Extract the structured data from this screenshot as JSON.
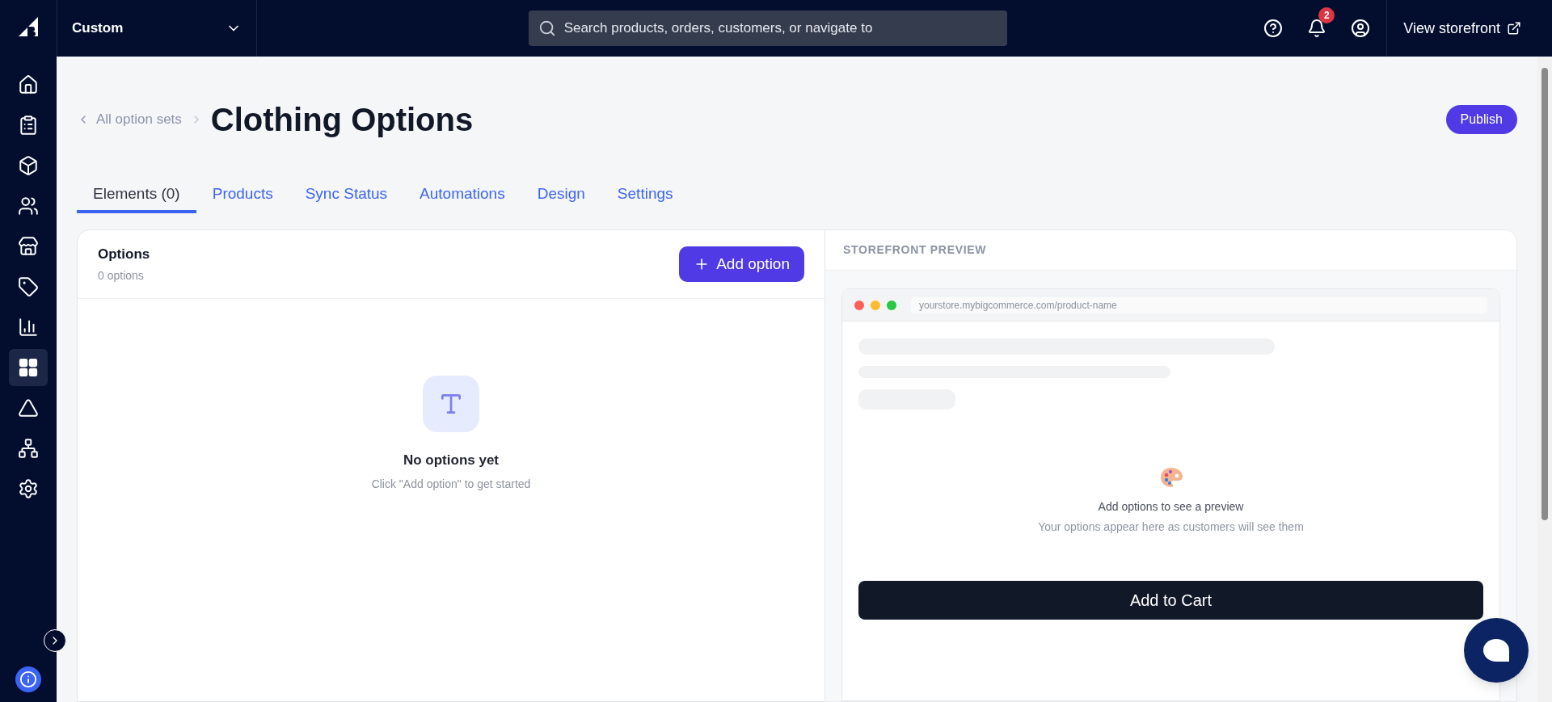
{
  "top_bar": {
    "store_selector": "Custom",
    "search": {
      "placeholder": "Search products, orders, customers, or navigate to"
    },
    "notifications_count": "2",
    "storefront_link": "View storefront"
  },
  "sidebar": {
    "items": [
      {
        "kind": "home",
        "selected": false
      },
      {
        "kind": "orders",
        "selected": false
      },
      {
        "kind": "products",
        "selected": false
      },
      {
        "kind": "customers",
        "selected": false
      },
      {
        "kind": "storefront",
        "selected": false
      },
      {
        "kind": "marketing",
        "selected": false
      },
      {
        "kind": "analytics",
        "selected": false
      },
      {
        "kind": "apps",
        "selected": true
      },
      {
        "kind": "channels",
        "selected": false
      },
      {
        "kind": "network",
        "selected": false
      },
      {
        "kind": "settings",
        "selected": false
      }
    ]
  },
  "header": {
    "breadcrumb": "All option sets",
    "title": "Clothing Options",
    "publish_button": "Publish"
  },
  "tabs": [
    {
      "label": "Elements (0)",
      "selected": true
    },
    {
      "label": "Products",
      "selected": false
    },
    {
      "label": "Sync Status",
      "selected": false
    },
    {
      "label": "Automations",
      "selected": false
    },
    {
      "label": "Design",
      "selected": false
    },
    {
      "label": "Settings",
      "selected": false
    }
  ],
  "options_panel": {
    "title": "Options",
    "count": "0 options",
    "add_button": "Add option",
    "empty_title": "No options yet",
    "empty_hint": "Click \"Add option\" to get started"
  },
  "preview_panel": {
    "title": "STOREFRONT PREVIEW",
    "url": "yourstore.mybigcommerce.com/product-name",
    "empty_title": "Add options to see a preview",
    "empty_hint": "Your options appear here as customers will see them",
    "cart_button": "Add to Cart"
  }
}
